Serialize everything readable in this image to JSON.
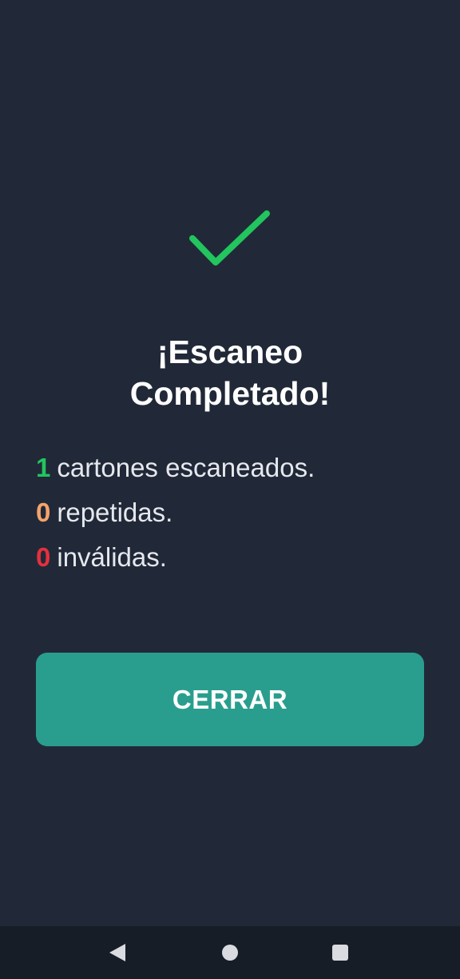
{
  "result": {
    "icon": "checkmark-icon",
    "title_line1": "¡Escaneo",
    "title_line2": "Completado!"
  },
  "stats": [
    {
      "count": "1",
      "label": "cartones escaneados.",
      "color": "#22c55e"
    },
    {
      "count": "0",
      "label": "repetidas.",
      "color": "#f4a46b"
    },
    {
      "count": "0",
      "label": "inválidas.",
      "color": "#e5303e"
    }
  ],
  "actions": {
    "close_label": "CERRAR"
  },
  "colors": {
    "background": "#212938",
    "accent": "#2a9e8e",
    "success": "#22c55e"
  },
  "navigation_bar": {
    "icons": [
      "back-icon",
      "home-icon",
      "recents-icon"
    ]
  }
}
